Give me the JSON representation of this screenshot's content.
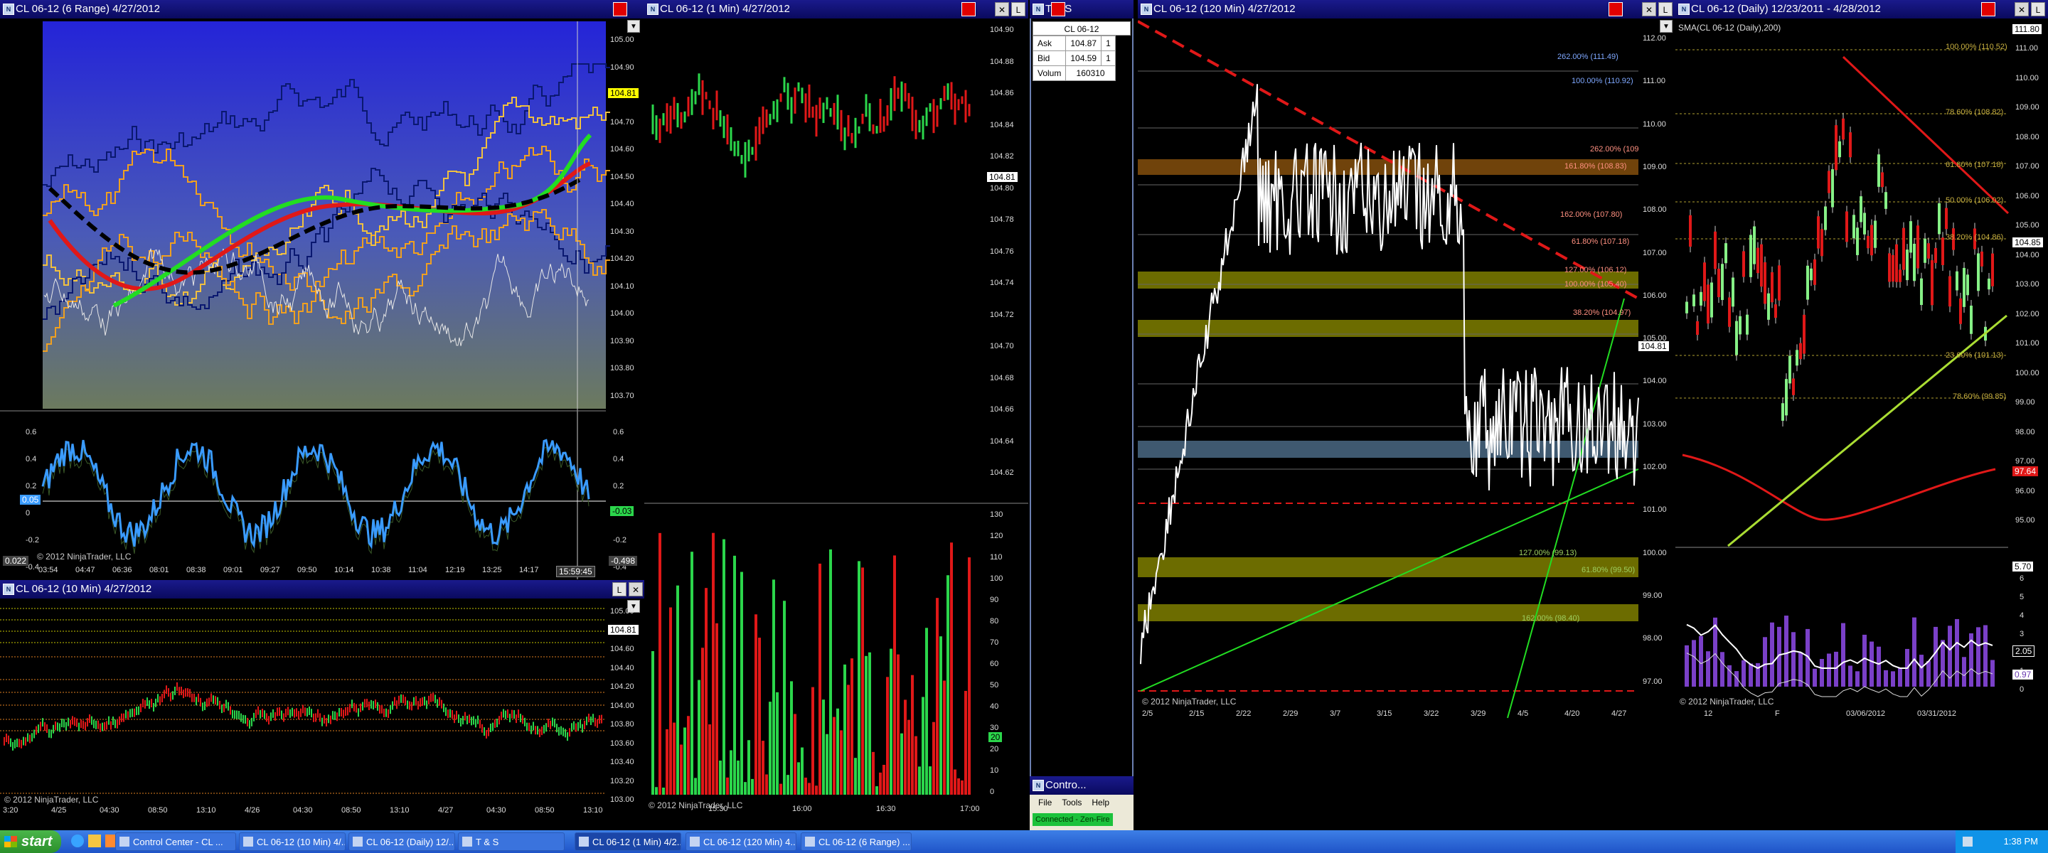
{
  "colors": {
    "title_bar": "#0a0a5e",
    "up": "#2bd64b",
    "down": "#e01818",
    "fib_yellow": "#c8c800",
    "accent_blue": "#3a9bff"
  },
  "windows": {
    "range": {
      "title": "CL 06-12 (6 Range)  4/27/2012",
      "price_axis": [
        "105.00",
        "104.90",
        "104.80",
        "104.70",
        "104.60",
        "104.50",
        "104.40",
        "104.30",
        "104.20",
        "104.10",
        "104.00",
        "103.90",
        "103.80",
        "103.70"
      ],
      "price_tag": "104.81",
      "osc_axis": [
        "0.6",
        "0.4",
        "0.2",
        "0",
        "-0.2",
        "-0.4"
      ],
      "osc_left_tag": "0.05",
      "osc_right_tag": "-0.03",
      "osc_bottom_left": "0.022",
      "osc_bottom_right": "-0.498",
      "time_axis": [
        "03:54",
        "04:47",
        "06:36",
        "08:01",
        "08:38",
        "09:01",
        "09:27",
        "09:50",
        "10:14",
        "10:38",
        "11:04",
        "12:19",
        "13:25",
        "14:17"
      ],
      "time_tag": "15:59:45",
      "copyright": "© 2012 NinjaTrader, LLC"
    },
    "tenmin": {
      "title": "CL 06-12 (10 Min)  4/27/2012",
      "price_axis": [
        "105.00",
        "104.80",
        "104.60",
        "104.40",
        "104.20",
        "104.00",
        "103.80",
        "103.60",
        "103.40",
        "103.20",
        "103.00"
      ],
      "price_tag": "104.81",
      "time_axis": [
        "3:20",
        "4/25",
        "04:30",
        "08:50",
        "13:10",
        "4/26",
        "04:30",
        "08:50",
        "13:10",
        "4/27",
        "04:30",
        "08:50",
        "13:10"
      ],
      "copyright": "© 2012 NinjaTrader, LLC"
    },
    "onemin": {
      "title": "CL 06-12 (1 Min)  4/27/2012",
      "price_axis": [
        "104.90",
        "104.88",
        "104.86",
        "104.84",
        "104.82",
        "104.80",
        "104.78",
        "104.76",
        "104.74",
        "104.72",
        "104.70",
        "104.68",
        "104.66",
        "104.64",
        "104.62"
      ],
      "price_tag": "104.81",
      "vol_axis": [
        "130",
        "120",
        "110",
        "100",
        "90",
        "80",
        "70",
        "60",
        "50",
        "40",
        "30",
        "20",
        "10",
        "0"
      ],
      "vol_tag": "20",
      "time_axis": [
        "15:30",
        "16:00",
        "16:30",
        "17:00"
      ],
      "copyright": "© 2012 NinjaTrader, LLC"
    },
    "ts": {
      "title": "T & S",
      "header": "CL 06-12",
      "rows": [
        {
          "label": "Ask",
          "price": "104.87",
          "size": "1"
        },
        {
          "label": "Bid",
          "price": "104.59",
          "size": "1"
        },
        {
          "label": "Volum",
          "price": "160310",
          "size": ""
        }
      ]
    },
    "control": {
      "title": "Contro...",
      "menu": [
        "File",
        "Tools",
        "Help"
      ],
      "status": "Connected - Zen-Fire"
    },
    "m120": {
      "title": "CL 06-12 (120 Min)  4/27/2012",
      "price_axis": [
        "112.00",
        "111.00",
        "110.00",
        "109.00",
        "108.00",
        "107.00",
        "106.00",
        "105.00",
        "104.00",
        "103.00",
        "102.00",
        "101.00",
        "100.00",
        "99.00",
        "98.00",
        "97.00"
      ],
      "price_tag": "104.81",
      "fib_labels": [
        "262.00% (111.49)",
        "100.00% (110.92)",
        "262.00% (109",
        "161.80% (108.83)",
        "162.00% (107.80)",
        "61.80% (107.18)",
        "127.00% (106.12)",
        "100.00% (105.40)",
        "38.20% (104.97)",
        "127.00% (99.13)",
        "61.80% (99.50)",
        "162.00% (98.40)"
      ],
      "time_axis": [
        "2/5",
        "2/15",
        "2/22",
        "2/29",
        "3/7",
        "3/15",
        "3/22",
        "3/29",
        "4/5",
        "4/20",
        "4/27"
      ],
      "copyright": "© 2012 NinjaTrader, LLC"
    },
    "daily": {
      "title": "CL 06-12 (Daily)  12/23/2011 - 4/28/2012",
      "indicator_label": "SMA(CL 06-12 (Daily),200)",
      "price_axis": [
        "111.00",
        "110.00",
        "109.00",
        "108.00",
        "107.00",
        "106.00",
        "105.00",
        "104.00",
        "103.00",
        "102.00",
        "101.00",
        "100.00",
        "99.00",
        "98.00",
        "97.00",
        "96.00",
        "95.00"
      ],
      "price_tag": "104.85",
      "sma_tag": "97.64",
      "top_tag": "111.80",
      "fib_labels": [
        "100.00% (110.52)",
        "78.60% (108.82)",
        "61.80% (107.18)",
        "50.00% (106.02)",
        "38.20% (104.86)",
        "23.60% (101.13)",
        "78.60% (99.85)"
      ],
      "lower_axis": [
        "6",
        "5",
        "4",
        "3",
        "2",
        "1",
        "0"
      ],
      "lower_tag1": "5.70",
      "lower_tag2": "2.05",
      "lower_tag3": "0.97",
      "time_axis": [
        "12",
        "F",
        "03/06/2012",
        "03/31/2012"
      ],
      "copyright": "© 2012 NinjaTrader, LLC"
    }
  },
  "taskbar": {
    "start": "start",
    "items": [
      "Control Center - CL ...",
      "CL 06-12 (10 Min) 4/...",
      "CL 06-12 (Daily) 12/...",
      "T & S",
      "CL 06-12 (1 Min) 4/2...",
      "CL 06-12 (120 Min) 4...",
      "CL 06-12 (6 Range) ..."
    ],
    "clock": "1:38 PM"
  }
}
